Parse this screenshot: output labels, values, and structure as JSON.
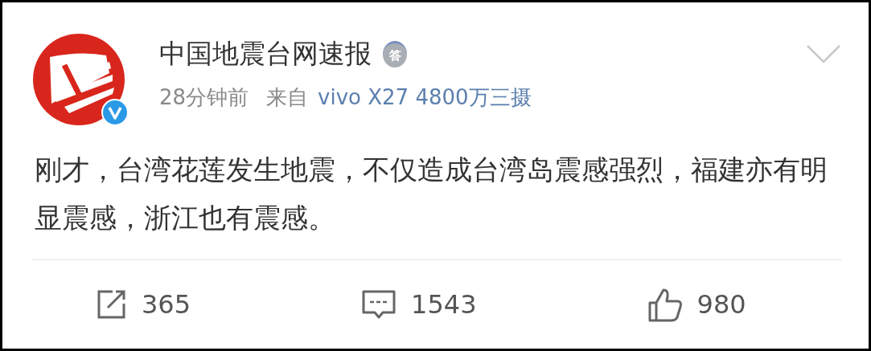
{
  "post": {
    "author": "中国地震台网速报",
    "author_badge": "答",
    "verified": true,
    "time": "28分钟前",
    "source_prefix": "来自",
    "source": "vivo X27 4800万三摄",
    "text": "刚才，台湾花莲发生地震，不仅造成台湾岛震感强烈，福建亦有明显震感，浙江也有震感。"
  },
  "actions": [
    {
      "kind": "repost",
      "count": "365"
    },
    {
      "kind": "comment",
      "count": "1543"
    },
    {
      "kind": "like",
      "count": "980"
    }
  ]
}
